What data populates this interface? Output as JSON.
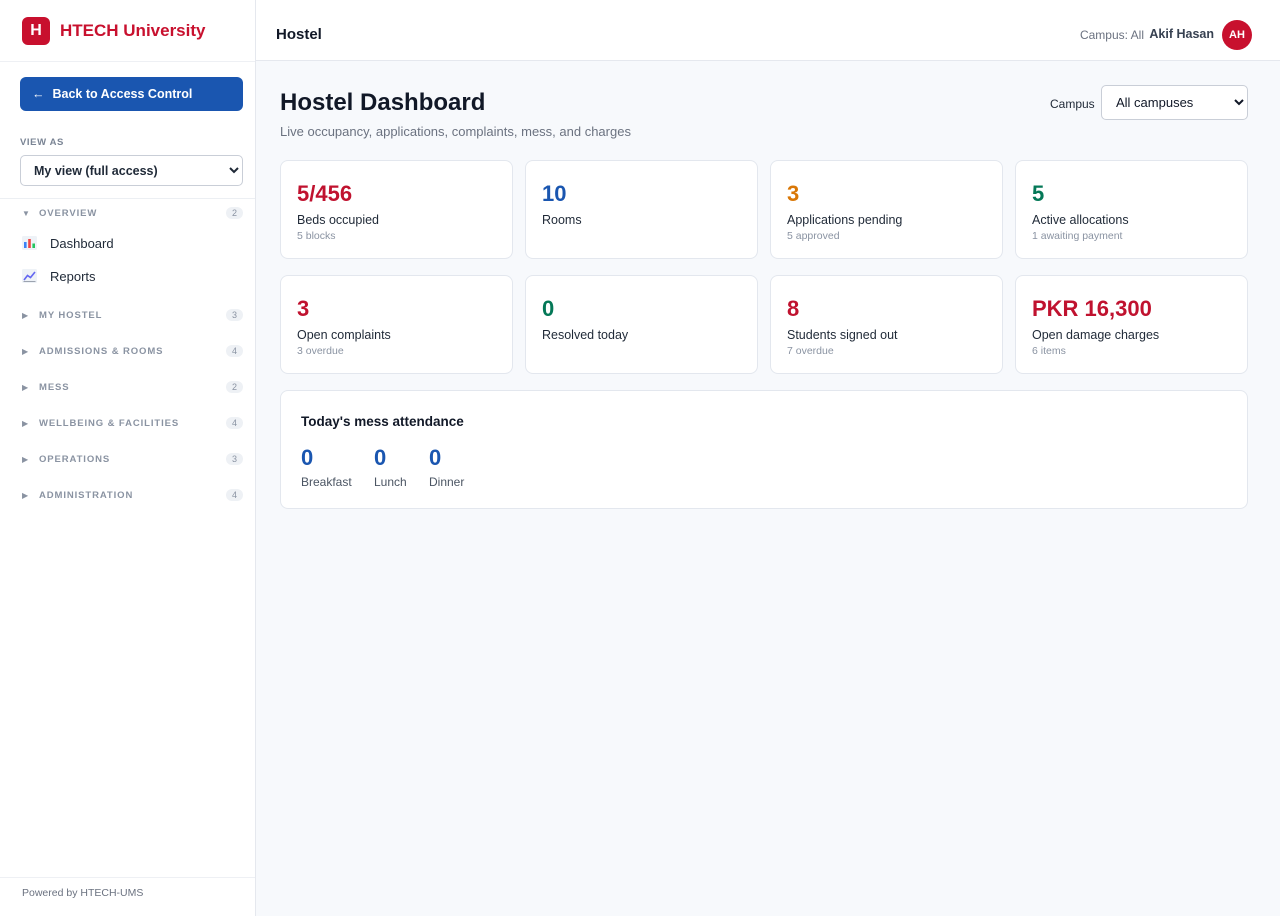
{
  "brand": {
    "logo_letter": "H",
    "name": "HTECH University"
  },
  "sidebar": {
    "back_label": "Back to Access Control",
    "back_arrow": "←",
    "view_as_label": "VIEW AS",
    "view_as_value": "My view (full access)",
    "sections": [
      {
        "label": "OVERVIEW",
        "count": "2",
        "expanded": true,
        "items": [
          {
            "label": "Dashboard",
            "icon": "bar-chart-icon"
          },
          {
            "label": "Reports",
            "icon": "line-chart-icon"
          }
        ]
      },
      {
        "label": "MY HOSTEL",
        "count": "3",
        "expanded": false
      },
      {
        "label": "ADMISSIONS & ROOMS",
        "count": "4",
        "expanded": false
      },
      {
        "label": "MESS",
        "count": "2",
        "expanded": false
      },
      {
        "label": "WELLBEING & FACILITIES",
        "count": "4",
        "expanded": false
      },
      {
        "label": "OPERATIONS",
        "count": "3",
        "expanded": false
      },
      {
        "label": "ADMINISTRATION",
        "count": "4",
        "expanded": false
      }
    ],
    "footer": "Powered by HTECH-UMS"
  },
  "topbar": {
    "title": "Hostel",
    "campus": "Campus: All",
    "user_name": "Akif Hasan",
    "user_initials": "AH"
  },
  "main": {
    "title": "Hostel Dashboard",
    "subtitle": "Live occupancy, applications, complaints, mess, and charges",
    "campus_label": "Campus",
    "campus_value": "All campuses",
    "cards": [
      {
        "value": "5/456",
        "label": "Beds occupied",
        "sub": "5 blocks",
        "color": "#c0122f"
      },
      {
        "value": "10",
        "label": "Rooms",
        "sub": "",
        "color": "#1a56b0"
      },
      {
        "value": "3",
        "label": "Applications pending",
        "sub": "5 approved",
        "color": "#d97706"
      },
      {
        "value": "5",
        "label": "Active allocations",
        "sub": "1 awaiting payment",
        "color": "#047857"
      },
      {
        "value": "3",
        "label": "Open complaints",
        "sub": "3 overdue",
        "color": "#c0122f"
      },
      {
        "value": "0",
        "label": "Resolved today",
        "sub": "",
        "color": "#047857"
      },
      {
        "value": "8",
        "label": "Students signed out",
        "sub": "7 overdue",
        "color": "#c0122f"
      },
      {
        "value": "PKR 16,300",
        "label": "Open damage charges",
        "sub": "6 items",
        "color": "#c0122f"
      }
    ],
    "mess": {
      "title": "Today's mess attendance",
      "meals": [
        {
          "value": "0",
          "label": "Breakfast"
        },
        {
          "value": "0",
          "label": "Lunch"
        },
        {
          "value": "0",
          "label": "Dinner"
        }
      ]
    }
  }
}
